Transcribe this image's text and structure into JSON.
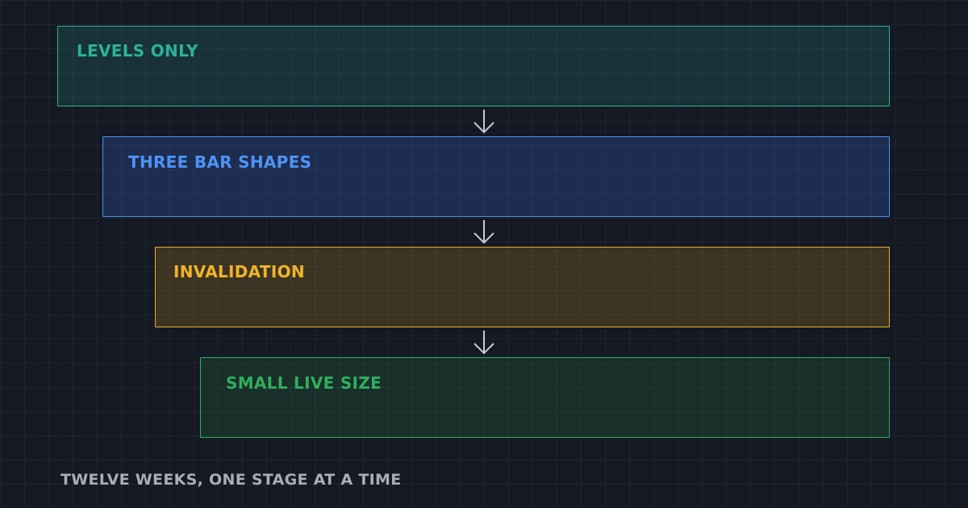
{
  "stages": [
    {
      "label": "LEVELS ONLY",
      "color": "#2bb39a"
    },
    {
      "label": "THREE BAR SHAPES",
      "color": "#4e93f5"
    },
    {
      "label": "INVALIDATION",
      "color": "#f0b428"
    },
    {
      "label": "SMALL LIVE SIZE",
      "color": "#2fae5c"
    }
  ],
  "arrow_icon": "arrow-down-icon",
  "caption": "TWELVE WEEKS, ONE STAGE AT A TIME"
}
